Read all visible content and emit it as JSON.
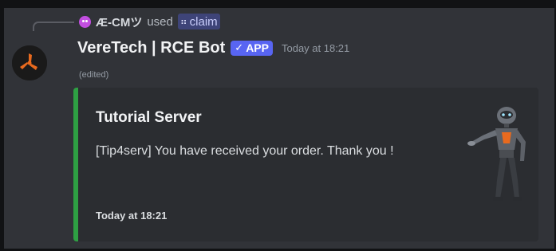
{
  "reply": {
    "avatar_icon": "user-avatar-icon",
    "username": "Æ-CMツ",
    "used_text": "used",
    "command_icon": "slash-command-icon",
    "command_name": "claim"
  },
  "message": {
    "avatar_icon": "bot-logo-icon",
    "author": "VereTech | RCE Bot",
    "badge_check": "✓",
    "badge_label": "APP",
    "timestamp": "Today at 18:21",
    "edited": "(edited)"
  },
  "embed": {
    "border_color": "#2ea043",
    "title": "Tutorial Server",
    "description": "[Tip4serv] You have received your order. Thank you !",
    "footer": "Today at 18:21",
    "thumbnail_icon": "robot-thumbnail-icon"
  },
  "colors": {
    "background": "#313338",
    "embed_background": "#2b2d31",
    "app_tag": "#5865f2",
    "avatar_accent": "#e86a1e"
  }
}
